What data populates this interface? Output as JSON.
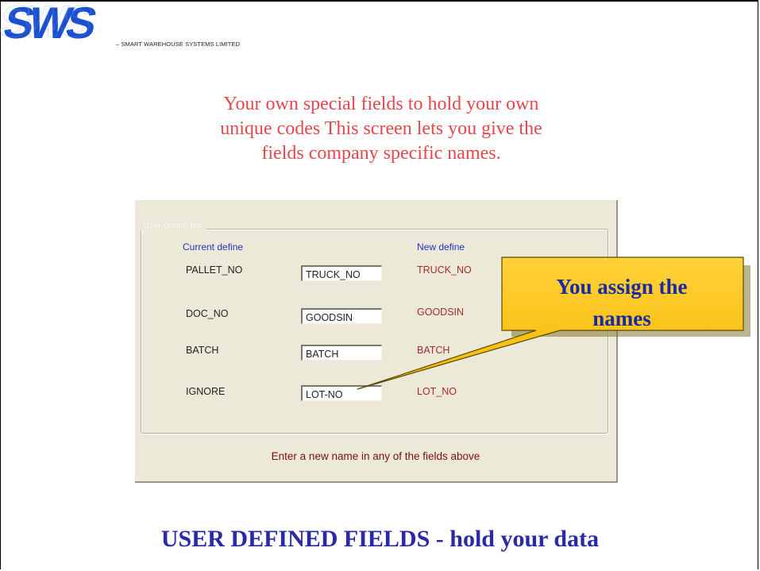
{
  "brand": {
    "logo_text": "SWS",
    "tagline": "– SMART WAREHOUSE SYSTEMS LIMITED",
    "logo_color": "#1a4fd0"
  },
  "intro": {
    "line1": "Your own special fields to hold your own",
    "line2": "unique codes This screen lets you give the",
    "line3": "fields company specific names."
  },
  "dialog": {
    "group_title": "User define bar",
    "col_current": "Current define",
    "col_new": "New define",
    "rows": [
      {
        "current": "PALLET_NO",
        "input": "TRUCK_NO",
        "new": "TRUCK_NO"
      },
      {
        "current": "DOC_NO",
        "input": "GOODSIN",
        "new": "GOODSIN"
      },
      {
        "current": "BATCH",
        "input": "BATCH",
        "new": "BATCH"
      },
      {
        "current": "IGNORE",
        "input": "LOT-NO",
        "new": "LOT_NO"
      }
    ],
    "hint": "Enter a new name in any of the fields above"
  },
  "callout": {
    "line1": "You assign the",
    "line2": "names",
    "fill": "#ffc20e"
  },
  "footer": {
    "title": "USER DEFINED FIELDS - hold your data"
  }
}
